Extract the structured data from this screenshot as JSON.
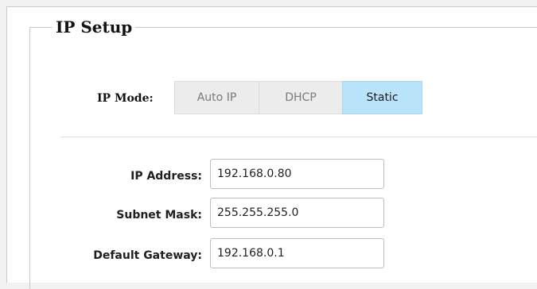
{
  "ip_setup": {
    "title": "IP Setup",
    "ip_mode": {
      "label": "IP Mode:",
      "options": [
        "Auto IP",
        "DHCP",
        "Static"
      ],
      "selected": "Static"
    },
    "fields": [
      {
        "label": "IP Address:",
        "value": "192.168.0.80"
      },
      {
        "label": "Subnet Mask:",
        "value": "255.255.255.0"
      },
      {
        "label": "Default Gateway:",
        "value": "192.168.0.1"
      }
    ]
  },
  "colors": {
    "active_segment": "#b9e3f8",
    "inactive_segment": "#ececec"
  }
}
